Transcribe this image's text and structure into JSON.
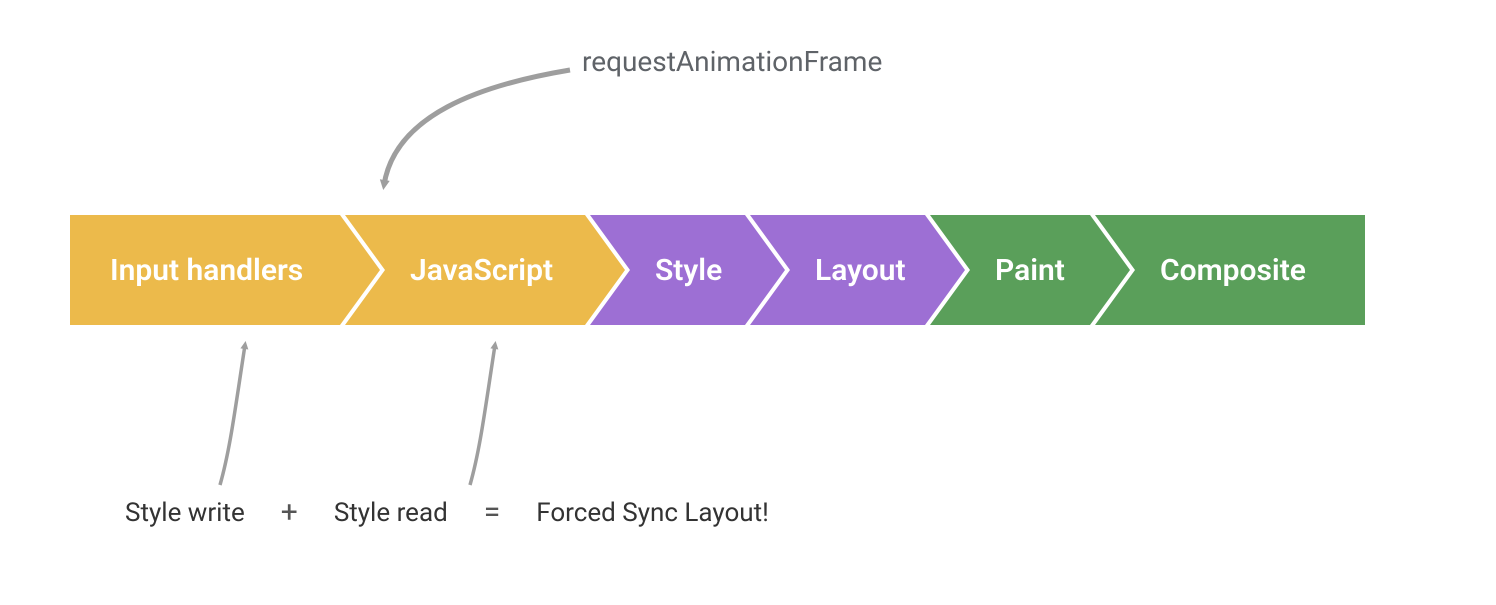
{
  "top_label": "requestAnimationFrame",
  "stages": {
    "s1": "Input handlers",
    "s2": "JavaScript",
    "s3": "Style",
    "s4": "Layout",
    "s5": "Paint",
    "s6": "Composite"
  },
  "bottom": {
    "t1": "Style write",
    "op1": "+",
    "t2": "Style read",
    "op2": "=",
    "t3": "Forced Sync Layout!"
  },
  "colors": {
    "yellow": "#ecba4b",
    "purple": "#9d6fd4",
    "green": "#5a9f5a",
    "arrow": "#9e9e9e"
  }
}
